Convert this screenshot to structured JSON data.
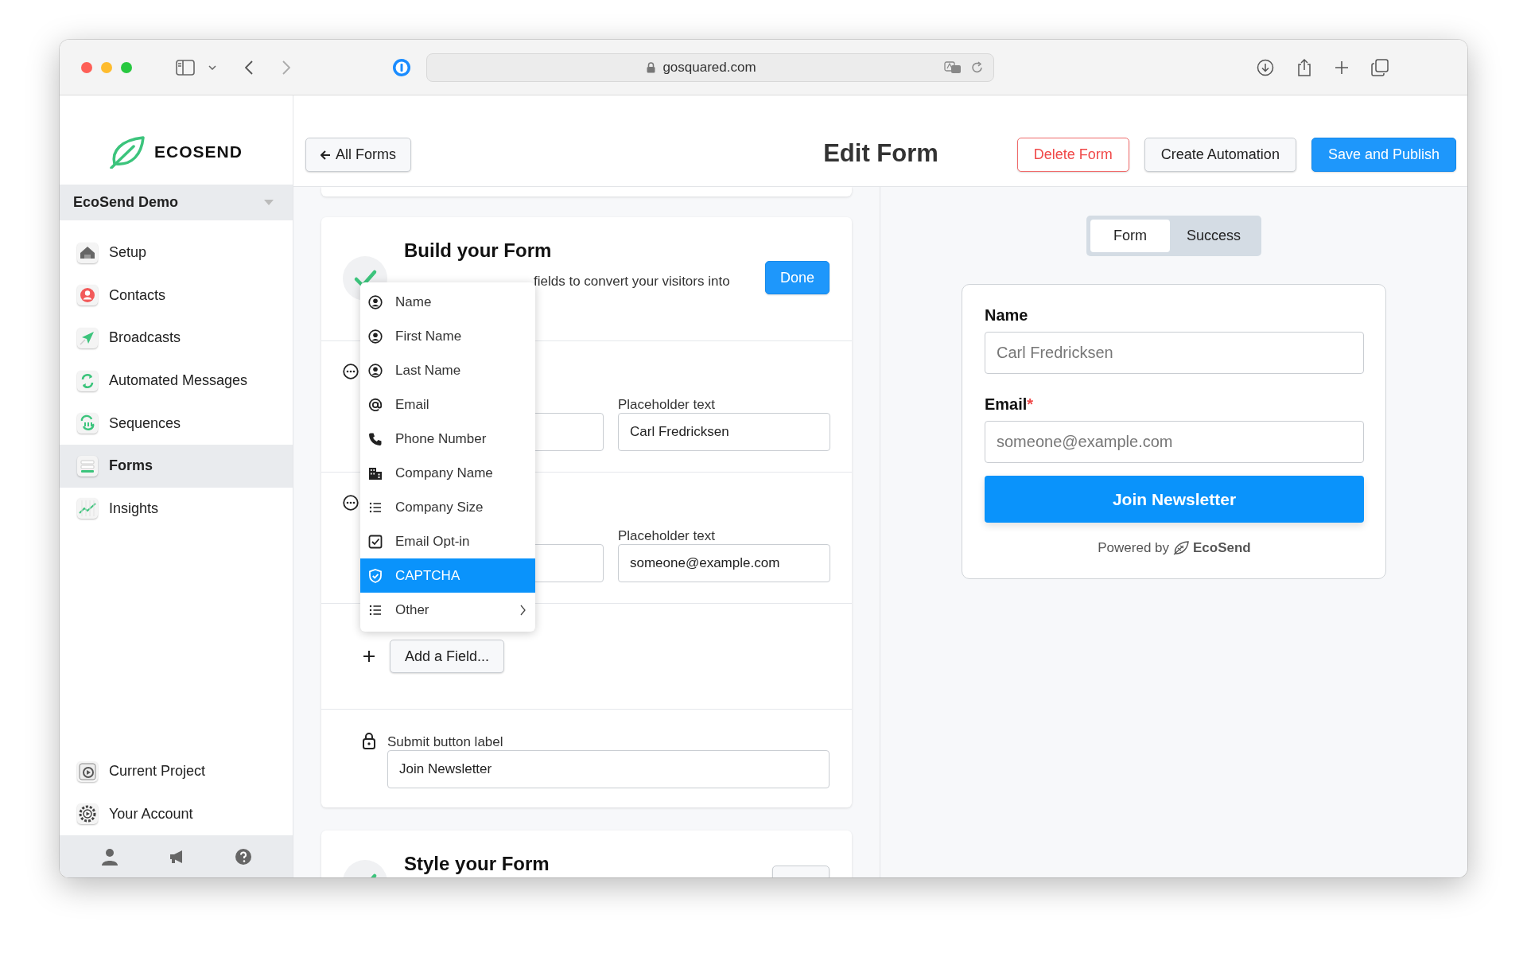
{
  "browser": {
    "url": "gosquared.com"
  },
  "sidebar": {
    "logo": "ECOSEND",
    "project": "EcoSend Demo",
    "items": [
      {
        "label": "Setup",
        "selected": false
      },
      {
        "label": "Contacts",
        "selected": false
      },
      {
        "label": "Broadcasts",
        "selected": false
      },
      {
        "label": "Automated Messages",
        "selected": false
      },
      {
        "label": "Sequences",
        "selected": false
      },
      {
        "label": "Forms",
        "selected": true
      },
      {
        "label": "Insights",
        "selected": false
      }
    ],
    "bottom_items": [
      {
        "label": "Current Project"
      },
      {
        "label": "Your Account"
      }
    ]
  },
  "header": {
    "back_button": "All Forms",
    "title": "Edit Form",
    "actions": [
      {
        "label": "Delete Form",
        "kind": "danger"
      },
      {
        "label": "Create Automation",
        "kind": "default"
      },
      {
        "label": "Save and Publish",
        "kind": "primary"
      }
    ]
  },
  "build_card": {
    "title": "Build your Form",
    "description": "fields to convert your visitors into",
    "done_button": "Done",
    "completed": true,
    "fields": [
      {
        "placeholder_label": "Placeholder text",
        "placeholder_value": "Carl Fredricksen"
      },
      {
        "placeholder_label": "Placeholder text",
        "placeholder_value": "someone@example.com"
      }
    ],
    "add_field_button": "Add a Field...",
    "submit_label": "Submit button label",
    "submit_value": "Join Newsletter"
  },
  "field_menu": {
    "items": [
      {
        "label": "Name",
        "selected": false,
        "has_submenu": false
      },
      {
        "label": "First Name",
        "selected": false,
        "has_submenu": false
      },
      {
        "label": "Last Name",
        "selected": false,
        "has_submenu": false
      },
      {
        "label": "Email",
        "selected": false,
        "has_submenu": false
      },
      {
        "label": "Phone Number",
        "selected": false,
        "has_submenu": false
      },
      {
        "label": "Company Name",
        "selected": false,
        "has_submenu": false
      },
      {
        "label": "Company Size",
        "selected": false,
        "has_submenu": false
      },
      {
        "label": "Email Opt-in",
        "selected": false,
        "has_submenu": false
      },
      {
        "label": "CAPTCHA",
        "selected": true,
        "has_submenu": false
      },
      {
        "label": "Other",
        "selected": false,
        "has_submenu": true
      }
    ]
  },
  "style_card": {
    "title": "Style your Form",
    "completed": true
  },
  "preview": {
    "tabs": [
      {
        "label": "Form",
        "selected": true
      },
      {
        "label": "Success",
        "selected": false
      }
    ],
    "required_mark": "*",
    "fields": [
      {
        "label": "Name",
        "placeholder": "Carl Fredricksen",
        "required": false
      },
      {
        "label": "Email",
        "placeholder": "someone@example.com",
        "required": true
      }
    ],
    "button": "Join Newsletter",
    "powered_by": "Powered by",
    "brand": "EcoSend"
  }
}
